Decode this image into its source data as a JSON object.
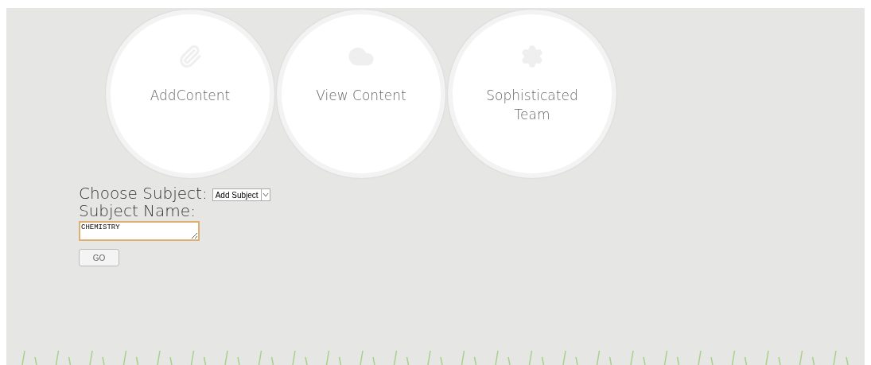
{
  "nav": [
    {
      "label": "AddContent"
    },
    {
      "label": "View Content"
    },
    {
      "label": "Sophisticated Team"
    }
  ],
  "form": {
    "subject_label": "Choose Subject:",
    "subject_select": {
      "value": "Add Subject"
    },
    "name_label": "Subject Name:",
    "name_field": {
      "value": "CHEMISTRY",
      "focused": true
    },
    "submit": "GO"
  }
}
